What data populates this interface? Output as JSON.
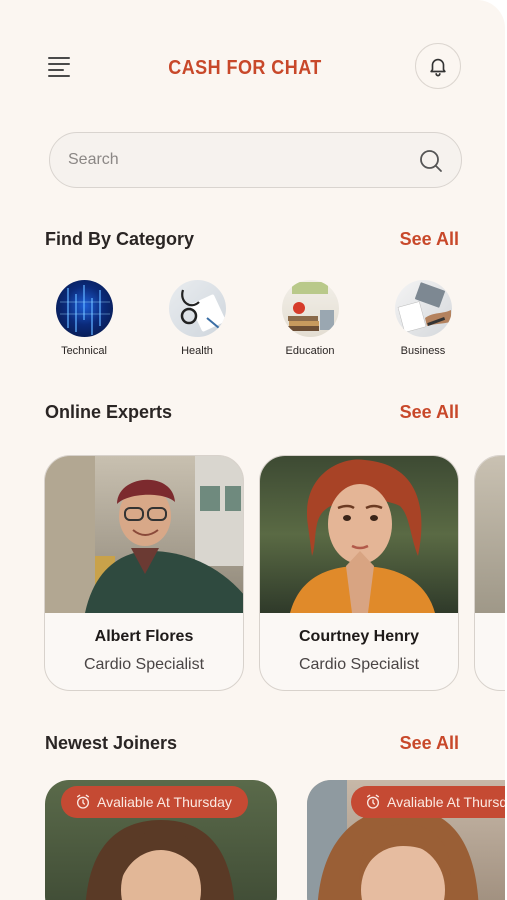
{
  "header": {
    "title": "CASH FOR CHAT"
  },
  "search": {
    "placeholder": "Search"
  },
  "categories": {
    "title": "Find By Category",
    "see_all": "See All",
    "items": [
      {
        "label": "Technical"
      },
      {
        "label": "Health"
      },
      {
        "label": "Education"
      },
      {
        "label": "Business"
      }
    ]
  },
  "experts": {
    "title": "Online Experts",
    "see_all": "See All",
    "items": [
      {
        "name": "Albert Flores",
        "specialty": "Cardio Specialist"
      },
      {
        "name": "Courtney Henry",
        "specialty": "Cardio Specialist"
      }
    ]
  },
  "joiners": {
    "title": "Newest Joiners",
    "see_all": "See All",
    "items": [
      {
        "badge": "Avaliable At Thursday"
      },
      {
        "badge": "Avaliable At Thursday"
      }
    ]
  },
  "colors": {
    "accent": "#c8482a",
    "background": "#fbf6f1"
  }
}
